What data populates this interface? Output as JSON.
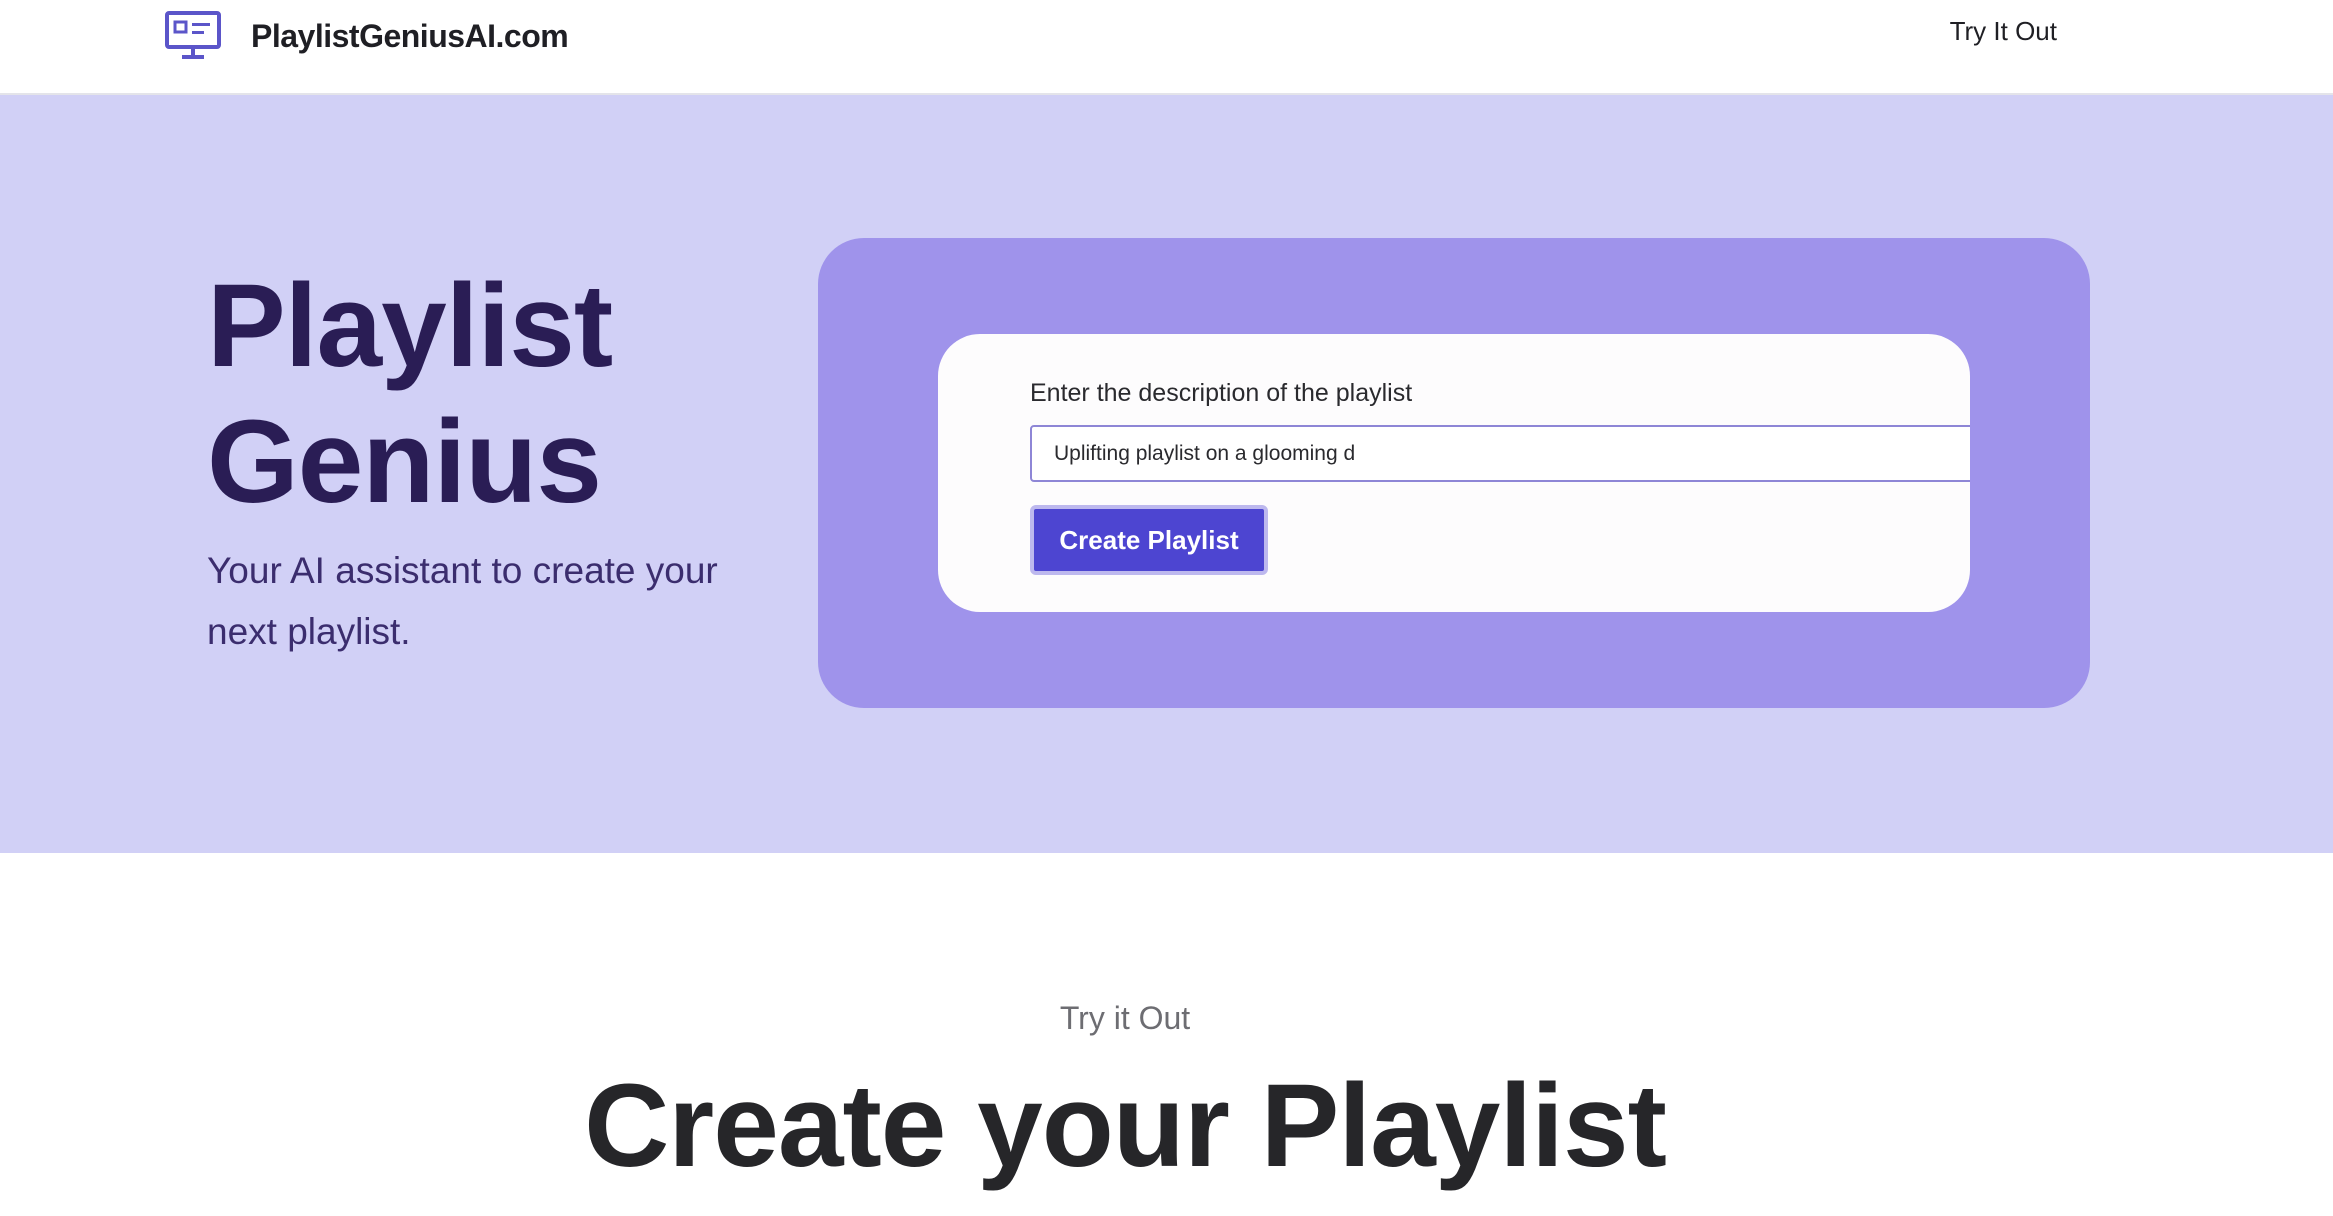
{
  "header": {
    "brand_name": "PlaylistGeniusAI.com",
    "brand_icon": "monitor-icon",
    "nav_link": "Try It Out"
  },
  "hero": {
    "title_line1": "Playlist",
    "title_line2": "Genius",
    "subtitle": "Your AI assistant to create your next playlist."
  },
  "demo": {
    "field_label": "Enter the description of the playlist",
    "input_value": "Uplifting playlist on a glooming d",
    "button_label": "Create Playlist"
  },
  "try_section": {
    "eyebrow": "Try it Out",
    "title": "Create your Playlist"
  },
  "colors": {
    "hero_background": "#d1d0f6",
    "panel_background": "#9f93eb",
    "button_background": "#4d45d1",
    "title_color": "#2a1d55",
    "brand_icon_color": "#5b55c9"
  }
}
